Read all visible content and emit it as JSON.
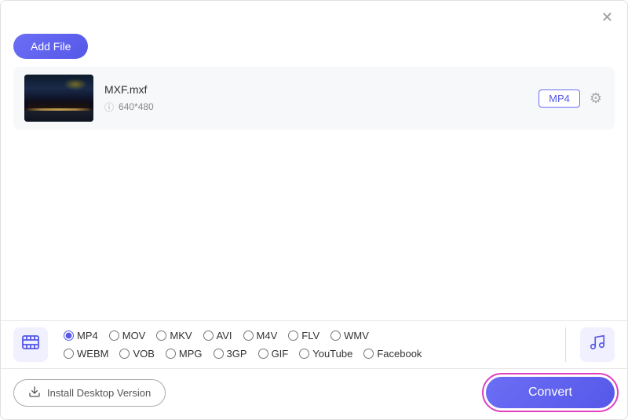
{
  "toolbar": {
    "add_file_label": "Add File"
  },
  "file": {
    "name": "MXF.mxf",
    "resolution": "640*480",
    "format": "MP4"
  },
  "format_selector": {
    "formats_row1": [
      {
        "id": "mp4",
        "label": "MP4",
        "checked": true
      },
      {
        "id": "mov",
        "label": "MOV",
        "checked": false
      },
      {
        "id": "mkv",
        "label": "MKV",
        "checked": false
      },
      {
        "id": "avi",
        "label": "AVI",
        "checked": false
      },
      {
        "id": "m4v",
        "label": "M4V",
        "checked": false
      },
      {
        "id": "flv",
        "label": "FLV",
        "checked": false
      },
      {
        "id": "wmv",
        "label": "WMV",
        "checked": false
      }
    ],
    "formats_row2": [
      {
        "id": "webm",
        "label": "WEBM",
        "checked": false
      },
      {
        "id": "vob",
        "label": "VOB",
        "checked": false
      },
      {
        "id": "mpg",
        "label": "MPG",
        "checked": false
      },
      {
        "id": "3gp",
        "label": "3GP",
        "checked": false
      },
      {
        "id": "gif",
        "label": "GIF",
        "checked": false
      },
      {
        "id": "youtube",
        "label": "YouTube",
        "checked": false
      },
      {
        "id": "facebook",
        "label": "Facebook",
        "checked": false
      }
    ]
  },
  "footer": {
    "install_label": "Install Desktop Version",
    "convert_label": "Convert"
  },
  "icons": {
    "close": "✕",
    "info": "ⓘ",
    "settings": "⚙",
    "film": "🎞",
    "music": "♪",
    "download": "⬇"
  }
}
